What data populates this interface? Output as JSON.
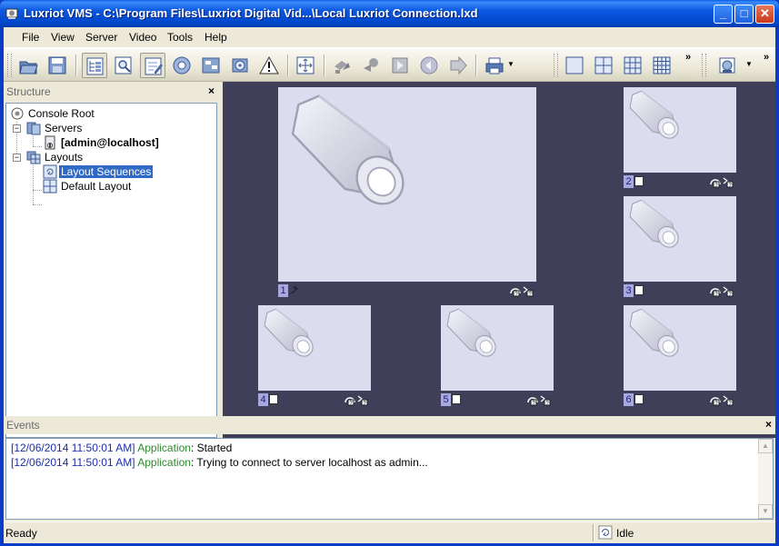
{
  "window": {
    "title": "Luxriot VMS - C:\\Program Files\\Luxriot Digital Vid...\\Local Luxriot Connection.lxd",
    "minimize": "_",
    "maximize": "□",
    "close": "✕"
  },
  "menu": [
    "File",
    "View",
    "Server",
    "Video",
    "Tools",
    "Help"
  ],
  "toolbar": {
    "overflow1": "»",
    "overflow2": "»"
  },
  "structure": {
    "title": "Structure",
    "close": "×",
    "items": [
      {
        "label": "Console Root"
      },
      {
        "label": "Servers"
      },
      {
        "label": "[admin@localhost]"
      },
      {
        "label": "Layouts"
      },
      {
        "label": "Layout Sequences"
      },
      {
        "label": "Default Layout"
      }
    ]
  },
  "cameras": [
    {
      "num": "1"
    },
    {
      "num": "2"
    },
    {
      "num": "3"
    },
    {
      "num": "4"
    },
    {
      "num": "5"
    },
    {
      "num": "6"
    }
  ],
  "events": {
    "title": "Events",
    "close": "×",
    "lines": [
      {
        "time": "[12/06/2014 11:50:01 AM]",
        "source": "Application",
        "message": ": Started"
      },
      {
        "time": "[12/06/2014 11:50:01 AM]",
        "source": "Application",
        "message": ": Trying to connect to server localhost as admin..."
      }
    ]
  },
  "status": {
    "left": "Ready",
    "right": "Idle"
  },
  "colors": {
    "title_bar": "#0a57e0",
    "view_bg": "#3f3f5a",
    "camera_bg": "#dcdcef",
    "selection": "#316ac5",
    "event_time": "#1b2fa8",
    "event_source": "#2d8a2d"
  }
}
